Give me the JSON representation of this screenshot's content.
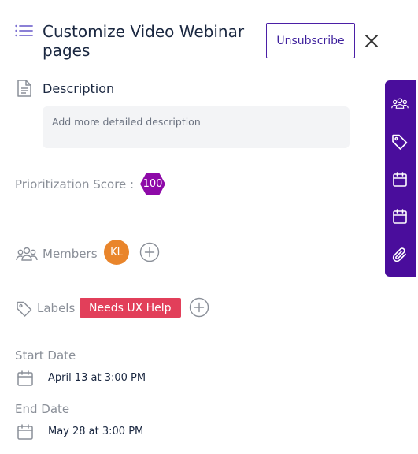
{
  "header": {
    "title": "Customize Video Webinar pages",
    "unsubscribe_label": "Unsubscribe"
  },
  "description": {
    "heading": "Description",
    "placeholder": "Add more detailed description"
  },
  "prioritization": {
    "label": "Prioritization Score :",
    "score": "100",
    "badge_color": "#8e0aa8"
  },
  "members": {
    "label": "Members",
    "avatars": [
      {
        "initials": "KL",
        "color": "#e9852b"
      }
    ]
  },
  "labels": {
    "label": "Labels",
    "chips": [
      {
        "text": "Needs UX Help",
        "color": "#e23f5a"
      }
    ]
  },
  "dates": {
    "start": {
      "label": "Start Date",
      "value": "April 13 at 3:00 PM"
    },
    "end": {
      "label": "End Date",
      "value": "May 28 at 3:00 PM"
    }
  },
  "toolbar": {
    "color": "#4a0d9c",
    "buttons": [
      "members-icon",
      "tag-icon",
      "calendar-icon",
      "calendar-icon",
      "paperclip-icon"
    ]
  },
  "colors": {
    "accent": "#3d1f9c",
    "label_text": "#8a8f98"
  }
}
